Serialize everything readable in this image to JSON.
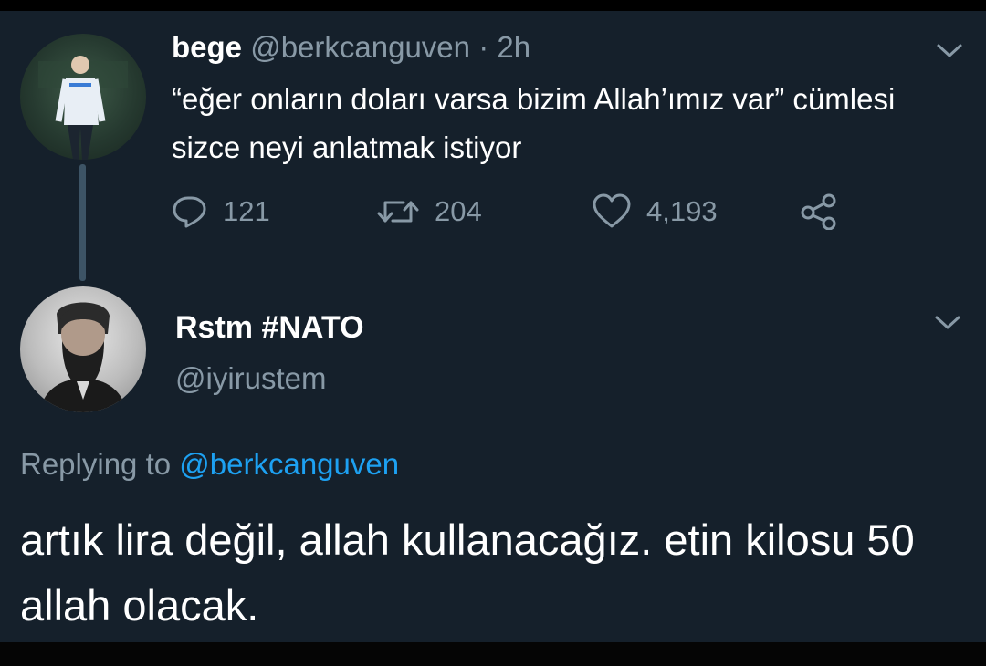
{
  "original_tweet": {
    "display_name": "bege",
    "handle": "@berkcanguven",
    "separator": "·",
    "time": "2h",
    "text": "“eğer onların doları varsa bizim Allah’ımız var” cümlesi sizce neyi anlatmak istiyor",
    "actions": {
      "reply_count": "121",
      "retweet_count": "204",
      "like_count": "4,193"
    }
  },
  "reply_tweet": {
    "display_name": "Rstm #NATO",
    "handle": "@iyirustem",
    "replying_prefix": "Replying to",
    "replying_to": "@berkcanguven",
    "text": "artık lira değil, allah kullanacağız. etin kilosu 50 allah olacak."
  },
  "icons": {
    "reply": "speech-bubble-icon",
    "retweet": "retweet-icon",
    "like": "heart-icon",
    "share": "share-icon",
    "menu": "chevron-down-icon"
  },
  "colors": {
    "background": "#15202b",
    "secondary_text": "#8899a6",
    "link": "#1da1f2",
    "thread_line": "#3d5466"
  }
}
